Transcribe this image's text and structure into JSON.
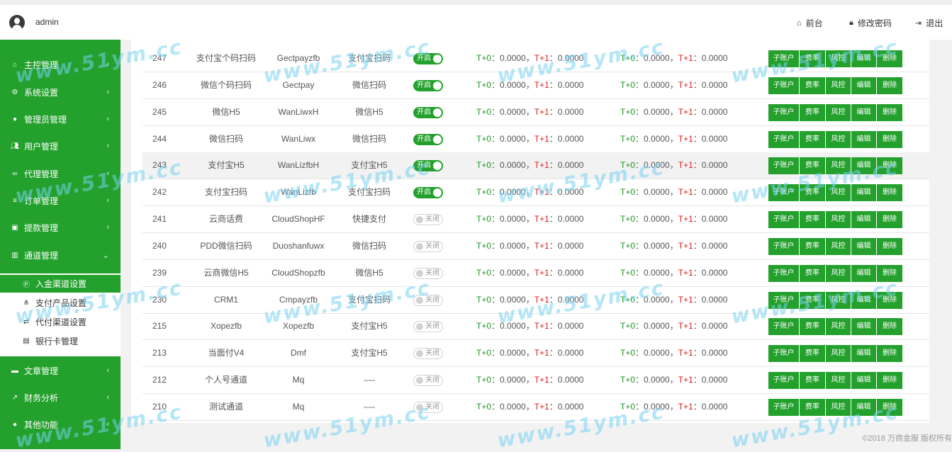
{
  "header": {
    "username": "admin",
    "links": [
      {
        "icon": "home-icon",
        "label": "前台"
      },
      {
        "icon": "lock-icon",
        "label": "修改密码"
      },
      {
        "icon": "logout-icon",
        "label": "退出"
      }
    ]
  },
  "sidebar": {
    "items": [
      {
        "icon": "home-icon",
        "label": "主控管理"
      },
      {
        "icon": "gears-icon",
        "label": "系统设置"
      },
      {
        "icon": "user-circle-icon",
        "label": "管理员管理"
      },
      {
        "icon": "users-icon",
        "label": "用户管理"
      },
      {
        "icon": "handshake-icon",
        "label": "代理管理"
      },
      {
        "icon": "list-icon",
        "label": "订单管理"
      },
      {
        "icon": "briefcase-icon",
        "label": "提款管理"
      },
      {
        "icon": "bank-icon",
        "label": "通道管理"
      },
      {
        "icon": "book-icon",
        "label": "文章管理"
      },
      {
        "icon": "chart-icon",
        "label": "财务分析"
      },
      {
        "icon": "user-circle-icon",
        "label": "其他功能"
      }
    ],
    "submenu": [
      {
        "icon": "p-circle-icon",
        "label": "入金渠道设置",
        "active": true
      },
      {
        "icon": "sitemap-icon",
        "label": "支付产品设置"
      },
      {
        "icon": "exchange-icon",
        "label": "代付渠道设置"
      },
      {
        "icon": "card-icon",
        "label": "银行卡管理"
      }
    ]
  },
  "table": {
    "rate_text": {
      "t0": "T+0",
      "t1": "T+1",
      "colon": "：",
      "val": "0.0000",
      "sep": "，"
    },
    "toggle_on": "开启",
    "toggle_off": "关闭",
    "actions": [
      "子账户",
      "费率",
      "风控",
      "编辑",
      "删除"
    ],
    "rows": [
      {
        "id": "247",
        "name": "支付宝个码扫码",
        "code": "Gectpayzfb",
        "type": "支付宝扫码",
        "on": true
      },
      {
        "id": "246",
        "name": "微信个码扫码",
        "code": "Gectpay",
        "type": "微信扫码",
        "on": true
      },
      {
        "id": "245",
        "name": "微信H5",
        "code": "WanLiwxH",
        "type": "微信H5",
        "on": true
      },
      {
        "id": "244",
        "name": "微信扫码",
        "code": "WanLiwx",
        "type": "微信扫码",
        "on": true
      },
      {
        "id": "243",
        "name": "支付宝H5",
        "code": "WanLizfbH",
        "type": "支付宝H5",
        "on": true
      },
      {
        "id": "242",
        "name": "支付宝扫码",
        "code": "WanLizfb",
        "type": "支付宝扫码",
        "on": true
      },
      {
        "id": "241",
        "name": "云商话费",
        "code": "CloudShopHF",
        "type": "快捷支付",
        "on": false
      },
      {
        "id": "240",
        "name": "PDD微信扫码",
        "code": "Duoshanfuwx",
        "type": "微信扫码",
        "on": false
      },
      {
        "id": "239",
        "name": "云商微信H5",
        "code": "CloudShopzfb",
        "type": "微信H5",
        "on": false
      },
      {
        "id": "230",
        "name": "CRM1",
        "code": "Cmpayzfb",
        "type": "支付宝扫码",
        "on": false
      },
      {
        "id": "215",
        "name": "Xopezfb",
        "code": "Xopezfb",
        "type": "支付宝H5",
        "on": false
      },
      {
        "id": "213",
        "name": "当面付V4",
        "code": "Dmf",
        "type": "支付宝H5",
        "on": false
      },
      {
        "id": "212",
        "name": "个人号通道",
        "code": "Mq",
        "type": "----",
        "on": false
      },
      {
        "id": "210",
        "name": "测试通道",
        "code": "Mq",
        "type": "----",
        "on": false
      }
    ]
  },
  "footer": {
    "copyright": "©2018 万商金服 版权所有"
  },
  "watermark": {
    "text": "www.51ym.cc"
  },
  "colors": {
    "accent": "#23a12c",
    "t1_red": "#e02020"
  }
}
